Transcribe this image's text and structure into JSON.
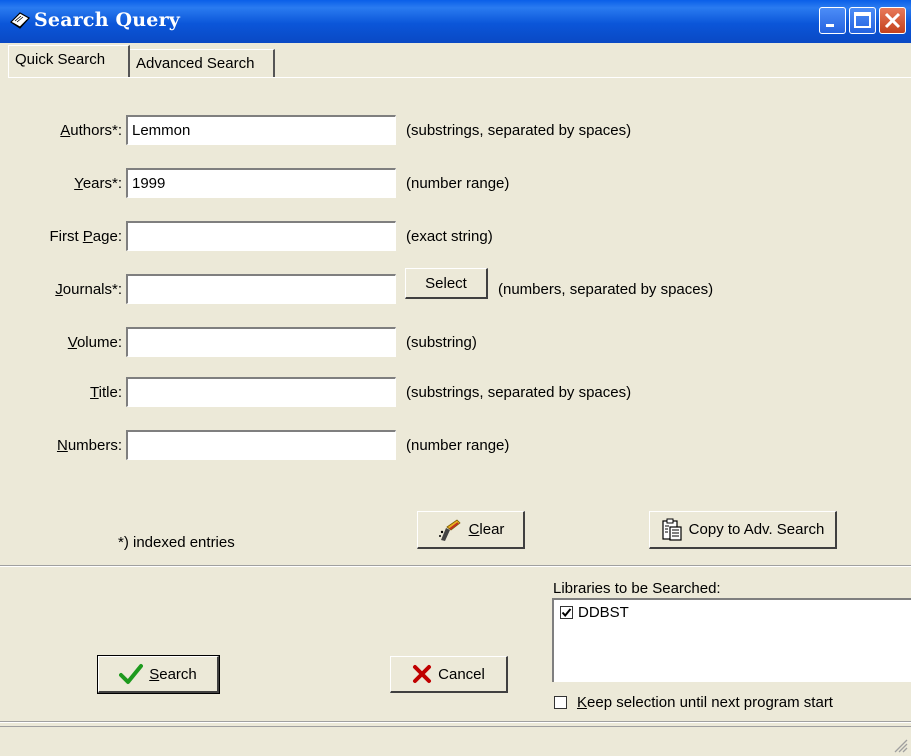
{
  "window": {
    "title": "Search Query"
  },
  "tabs": [
    {
      "label": "Quick Search",
      "active": true
    },
    {
      "label": "Advanced Search",
      "active": false
    }
  ],
  "form": {
    "authors": {
      "label_pre": "",
      "label_key": "A",
      "label_post": "uthors*:",
      "value": "Lemmon",
      "hint": "(substrings, separated by spaces)"
    },
    "years": {
      "label_pre": "",
      "label_key": "Y",
      "label_post": "ears*:",
      "value": "1999",
      "hint": "(number range)"
    },
    "first_page": {
      "label_pre": "First ",
      "label_key": "P",
      "label_post": "age:",
      "value": "",
      "hint": "(exact string)"
    },
    "journals": {
      "label_pre": "",
      "label_key": "J",
      "label_post": "ournals*:",
      "value": "",
      "hint": "(numbers, separated by spaces)",
      "select_label": "Select"
    },
    "volume": {
      "label_pre": "",
      "label_key": "V",
      "label_post": "olume:",
      "value": "",
      "hint": "(substring)"
    },
    "title": {
      "label_pre": "",
      "label_key": "T",
      "label_post": "itle:",
      "value": "",
      "hint": "(substrings, separated by spaces)"
    },
    "numbers": {
      "label_pre": "",
      "label_key": "N",
      "label_post": "umbers:",
      "value": "",
      "hint": "(number range)"
    }
  },
  "indexed_note": "*) indexed entries",
  "buttons": {
    "clear_key": "C",
    "clear_rest": "lear",
    "copy": "Copy to Adv. Search",
    "search_key": "S",
    "search_rest": "earch",
    "cancel": "Cancel"
  },
  "libraries": {
    "label": "Libraries to be Searched:",
    "items": [
      {
        "name": "DDBST",
        "checked": true
      }
    ],
    "keep_key": "K",
    "keep_rest": "eep selection until next program start",
    "keep_checked": false
  },
  "colors": {
    "titlebar": "#0A56D9",
    "face": "#ECE9D8",
    "check_green": "#1E9A1E",
    "cancel_red": "#C00000"
  }
}
